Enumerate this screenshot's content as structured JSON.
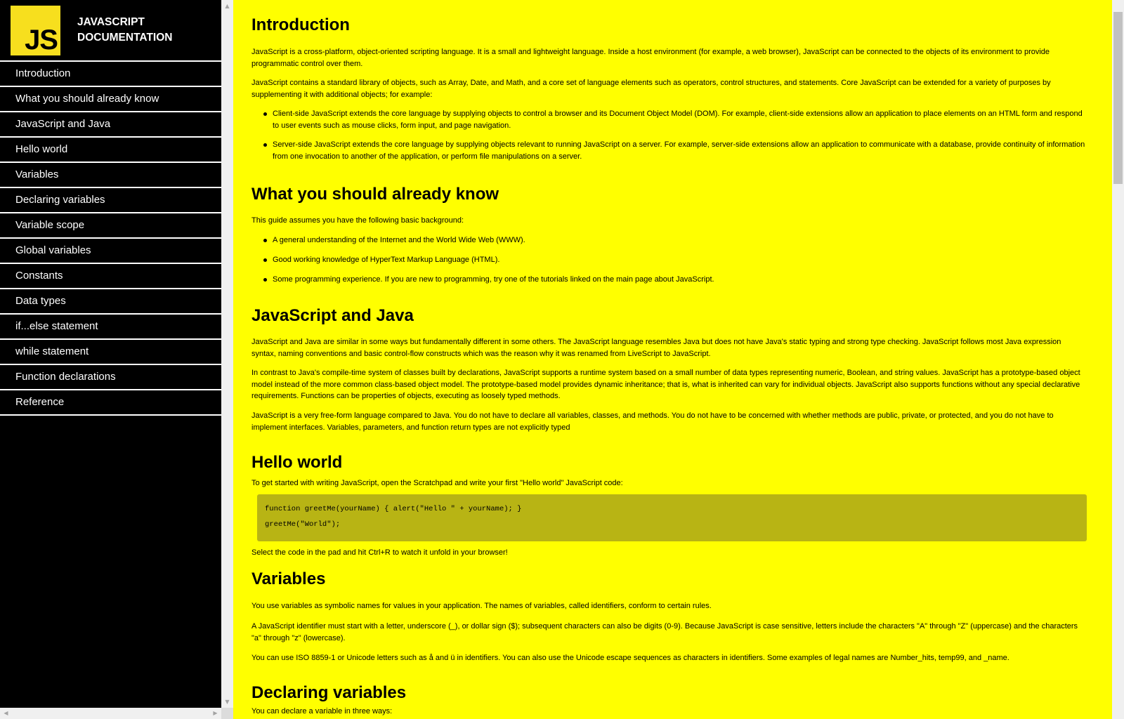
{
  "sidebar": {
    "logo_text": "JS",
    "title_line1": "JAVASCRIPT",
    "title_line2": "DOCUMENTATION",
    "items": [
      {
        "label": "Introduction"
      },
      {
        "label": "What you should already know"
      },
      {
        "label": "JavaScript and Java"
      },
      {
        "label": "Hello world"
      },
      {
        "label": "Variables"
      },
      {
        "label": "Declaring variables"
      },
      {
        "label": "Variable scope"
      },
      {
        "label": "Global variables"
      },
      {
        "label": "Constants"
      },
      {
        "label": "Data types"
      },
      {
        "label": "if...else statement"
      },
      {
        "label": "while statement"
      },
      {
        "label": "Function declarations"
      },
      {
        "label": "Reference"
      }
    ]
  },
  "scroll": {
    "up_arrow": "▲",
    "down_arrow": "▼",
    "left_arrow": "◀",
    "right_arrow": "▶"
  },
  "colors": {
    "main_background": "#ffff00",
    "sidebar_background": "#000000",
    "logo_background": "#f7df1e",
    "code_background": "#b8b414"
  },
  "content": {
    "introduction": {
      "title": "Introduction",
      "p1": "JavaScript is a cross-platform, object-oriented scripting language. It is a small and lightweight language. Inside a host environment (for example, a web browser), JavaScript can be connected to the objects of its environment to provide programmatic control over them.",
      "p2": "JavaScript contains a standard library of objects, such as Array, Date, and Math, and a core set of language elements such as operators, control structures, and statements. Core JavaScript can be extended for a variety of purposes by supplementing it with additional objects; for example:",
      "bullets": [
        "Client-side JavaScript extends the core language by supplying objects to control a browser and its Document Object Model (DOM). For example, client-side extensions allow an application to place elements on an HTML form and respond to user events such as mouse clicks, form input, and page navigation.",
        "Server-side JavaScript extends the core language by supplying objects relevant to running JavaScript on a server. For example, server-side extensions allow an application to communicate with a database, provide continuity of information from one invocation to another of the application, or perform file manipulations on a server."
      ]
    },
    "already_know": {
      "title": "What you should already know",
      "p1": "This guide assumes you have the following basic background:",
      "bullets": [
        "A general understanding of the Internet and the World Wide Web (WWW).",
        "Good working knowledge of HyperText Markup Language (HTML).",
        "Some programming experience. If you are new to programming, try one of the tutorials linked on the main page about JavaScript."
      ]
    },
    "js_and_java": {
      "title": "JavaScript and Java",
      "p1": "JavaScript and Java are similar in some ways but fundamentally different in some others. The JavaScript language resembles Java but does not have Java's static typing and strong type checking. JavaScript follows most Java expression syntax, naming conventions and basic control-flow constructs which was the reason why it was renamed from LiveScript to JavaScript.",
      "p2": "In contrast to Java's compile-time system of classes built by declarations, JavaScript supports a runtime system based on a small number of data types representing numeric, Boolean, and string values. JavaScript has a prototype-based object model instead of the more common class-based object model. The prototype-based model provides dynamic inheritance; that is, what is inherited can vary for individual objects. JavaScript also supports functions without any special declarative requirements. Functions can be properties of objects, executing as loosely typed methods.",
      "p3": "JavaScript is a very free-form language compared to Java. You do not have to declare all variables, classes, and methods. You do not have to be concerned with whether methods are public, private, or protected, and you do not have to implement interfaces. Variables, parameters, and function return types are not explicitly typed"
    },
    "hello_world": {
      "title": "Hello world",
      "p1": "To get started with writing JavaScript, open the Scratchpad and write your first \"Hello world\" JavaScript code:",
      "code_line1": "function greetMe(yourName) { alert(\"Hello \" + yourName); }",
      "code_line2": "greetMe(\"World\");",
      "p2": "Select the code in the pad and hit Ctrl+R to watch it unfold in your browser!"
    },
    "variables": {
      "title": "Variables",
      "p1": "You use variables as symbolic names for values in your application. The names of variables, called identifiers, conform to certain rules.",
      "p2": "A JavaScript identifier must start with a letter, underscore (_), or dollar sign ($); subsequent characters can also be digits (0-9). Because JavaScript is case sensitive, letters include the characters \"A\" through \"Z\" (uppercase) and the characters \"a\" through \"z\" (lowercase).",
      "p3": "You can use ISO 8859-1 or Unicode letters such as å and ü in identifiers. You can also use the Unicode escape sequences as characters in identifiers. Some examples of legal names are Number_hits, temp99, and _name."
    },
    "declaring": {
      "title": "Declaring variables",
      "p1": "You can declare a variable in three ways:"
    }
  }
}
